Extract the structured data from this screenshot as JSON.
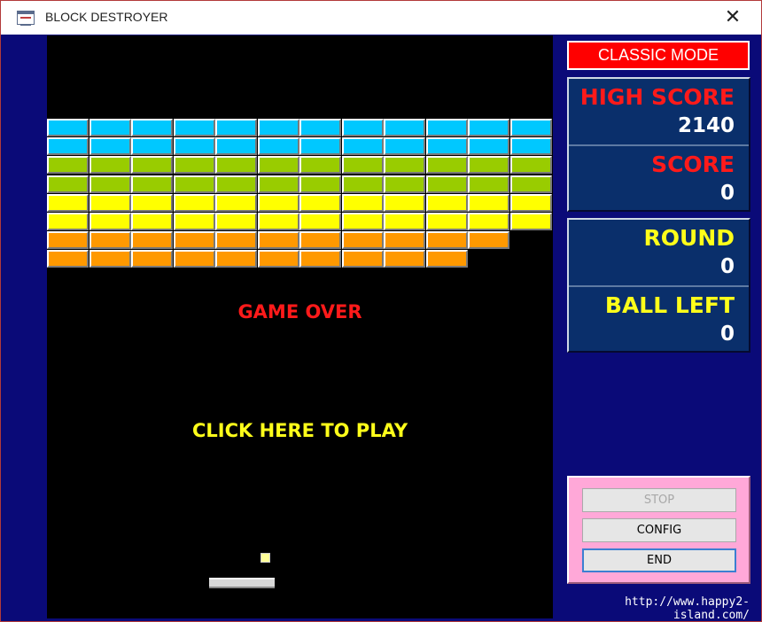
{
  "window": {
    "title": "BLOCK DESTROYER",
    "close_glyph": "✕"
  },
  "playfield": {
    "game_over_text": "GAME OVER",
    "play_text": "CLICK HERE TO PLAY",
    "brick_colors": [
      "#00c8ff",
      "#00c8ff",
      "#99cc00",
      "#99cc00",
      "#ffff00",
      "#ffff00",
      "#ff9900",
      "#ff9900"
    ],
    "bricks_per_row": [
      12,
      12,
      12,
      12,
      12,
      12,
      11,
      10
    ]
  },
  "sidebar": {
    "mode_label": "CLASSIC MODE",
    "high_score_label": "HIGH SCORE",
    "high_score_value": "2140",
    "score_label": "SCORE",
    "score_value": "0",
    "round_label": "ROUND",
    "round_value": "0",
    "ball_left_label": "BALL LEFT",
    "ball_left_value": "0"
  },
  "controls": {
    "stop_label": "STOP",
    "config_label": "CONFIG",
    "end_label": "END"
  },
  "footer": {
    "url": "http://www.happy2-island.com/"
  }
}
